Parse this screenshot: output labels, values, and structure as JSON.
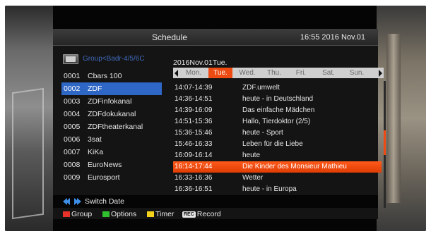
{
  "header": {
    "title": "Schedule",
    "clock": "16:55 2016 Nov.01"
  },
  "group": {
    "icon": "tv-icon",
    "label": "Group<Badr-4/5/6C"
  },
  "channels": [
    {
      "num": "0001",
      "name": "Cbars 100"
    },
    {
      "num": "0002",
      "name": "ZDF",
      "selected": true
    },
    {
      "num": "0003",
      "name": "ZDFinfokanal"
    },
    {
      "num": "0004",
      "name": "ZDFdokukanal"
    },
    {
      "num": "0005",
      "name": "ZDFtheaterkanal"
    },
    {
      "num": "0006",
      "name": "3sat"
    },
    {
      "num": "0007",
      "name": "KiKa"
    },
    {
      "num": "0008",
      "name": "EuroNews"
    },
    {
      "num": "0009",
      "name": "Eurosport"
    }
  ],
  "schedule": {
    "date": "2016Nov.01Tue.",
    "days": [
      "Mon.",
      "Tue.",
      "Wed.",
      "Thu.",
      "Fri.",
      "Sat.",
      "Sun."
    ],
    "selected_day": "Tue.",
    "events": [
      {
        "time": "14:07-14:39",
        "title": "ZDF.umwelt"
      },
      {
        "time": "14:36-14:51",
        "title": "heute - in Deutschland"
      },
      {
        "time": "14:39-16:09",
        "title": "Das einfache Mädchen"
      },
      {
        "time": "14:51-15:36",
        "title": "Hallo, Tierdoktor (2/5)"
      },
      {
        "time": "15:36-15:46",
        "title": "heute - Sport"
      },
      {
        "time": "15:46-16:33",
        "title": "Leben für die Liebe"
      },
      {
        "time": "16:09-16:14",
        "title": "heute"
      },
      {
        "time": "16:14-17:44",
        "title": "Die Kinder des Monsieur Mathieu",
        "selected": true
      },
      {
        "time": "16:33-16:36",
        "title": "Wetter"
      },
      {
        "time": "16:36-16:51",
        "title": "heute - in Europa"
      }
    ]
  },
  "switch_date": {
    "label": "Switch Date"
  },
  "footer": {
    "group": {
      "label": "Group",
      "color": "#e8322a"
    },
    "options": {
      "label": "Options",
      "color": "#2fbf2f"
    },
    "timer": {
      "label": "Timer",
      "color": "#f2d21a"
    },
    "record": {
      "badge": "REC",
      "label": "Record"
    }
  },
  "colors": {
    "accent": "#ee4b12",
    "selection_blue": "#2f67c6"
  }
}
